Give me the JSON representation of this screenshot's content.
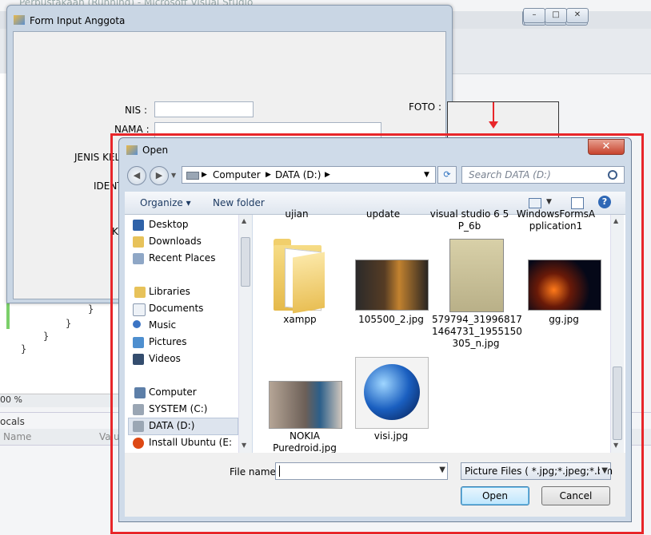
{
  "vs": {
    "title": "Perpustakaan (Running) - Microsoft Visual Studio",
    "zoom": "00 %",
    "locals_title": "ocals",
    "locals_col_name": "Name",
    "locals_col_value": "Valu"
  },
  "form": {
    "title": "Form Input Anggota",
    "nis_label": "NIS :",
    "nama_label": "NAMA :",
    "jenis_label": "JENIS KEL",
    "ident_label": "IDENT",
    "k_label": "K",
    "foto_label": "FOTO :"
  },
  "dialog": {
    "title": "Open",
    "close_glyph": "✕",
    "breadcrumb": [
      "Computer",
      "DATA (D:)"
    ],
    "search_placeholder": "Search DATA (D:)",
    "organize": "Organize",
    "new_folder": "New folder",
    "nav": {
      "favorites": [
        "Desktop",
        "Downloads",
        "Recent Places"
      ],
      "libraries_header": "Libraries",
      "libraries": [
        "Documents",
        "Music",
        "Pictures",
        "Videos"
      ],
      "computer_header": "Computer",
      "drives": [
        "SYSTEM (C:)",
        "DATA (D:)",
        "Install Ubuntu (E:"
      ]
    },
    "top_cut_files": [
      "ujian",
      "update",
      "visual studio 6 5\nP_6b",
      "WindowsFormsA\npplication1"
    ],
    "files_row1": [
      {
        "name": "xampp",
        "kind": "folder"
      },
      {
        "name": "105500_2.jpg",
        "kind": "image"
      },
      {
        "name": "579794_31996817\n1464731_1955150\n305_n.jpg",
        "kind": "image"
      },
      {
        "name": "gg.jpg",
        "kind": "image"
      }
    ],
    "files_row2": [
      {
        "name": "NOKIA\nPuredroid.jpg",
        "kind": "image"
      },
      {
        "name": "visi.jpg",
        "kind": "image"
      }
    ],
    "file_name_label": "File name:",
    "file_name_value": "",
    "filter": "Picture Files  ( *.jpg;*.jpeg;*.bm",
    "open_button": "Open",
    "cancel_button": "Cancel"
  },
  "colors": {
    "highlight_red": "#e8262a",
    "window_frame": "#cfdbe9",
    "selection": "#dde4ee"
  }
}
